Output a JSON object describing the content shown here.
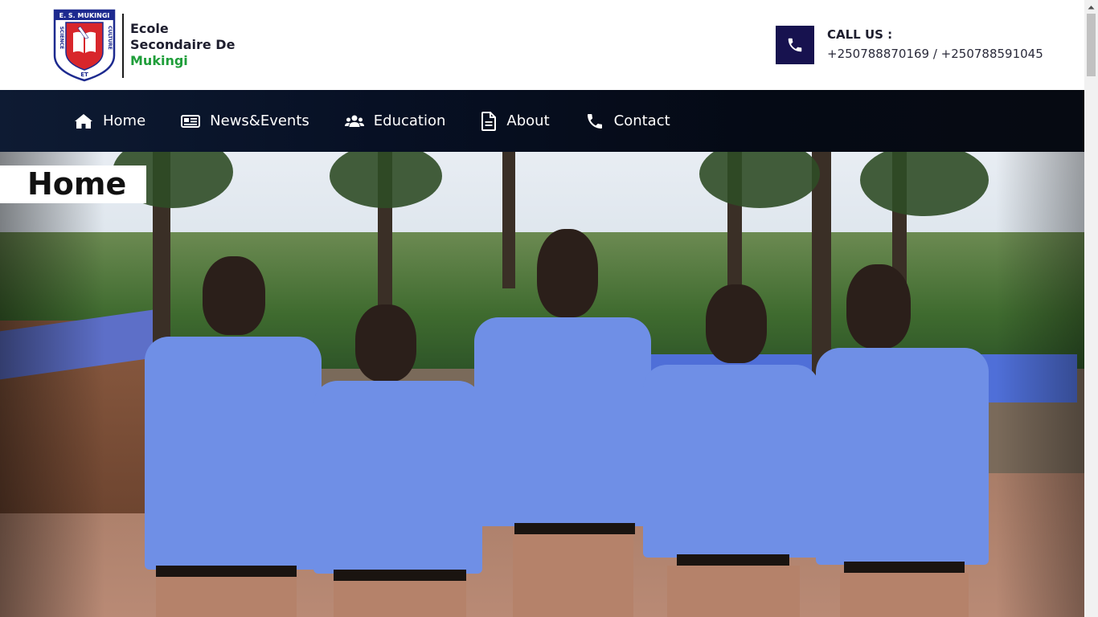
{
  "header": {
    "logo": {
      "crest_top_text": "E. S. MUKINGI",
      "crest_left_text": "SCIENCE",
      "crest_right_text": "CULTURE",
      "crest_bottom_text": "ET"
    },
    "school_name_line1": "Ecole",
    "school_name_line2": "Secondaire De",
    "school_name_line3": "Mukingi",
    "call_label": "CALL US :",
    "call_numbers": "+250788870169 / +250788591045",
    "call_icon": "phone-icon"
  },
  "nav": {
    "items": [
      {
        "label": "Home",
        "icon": "home-icon"
      },
      {
        "label": "News&Events",
        "icon": "newspaper-icon"
      },
      {
        "label": "Education",
        "icon": "users-icon"
      },
      {
        "label": "About",
        "icon": "document-icon"
      },
      {
        "label": "Contact",
        "icon": "phone-icon"
      }
    ]
  },
  "hero": {
    "page_title": "Home",
    "image": "group-of-students-in-uniform-photo"
  },
  "colors": {
    "brand_navy": "#17124f",
    "nav_background": "#050a15",
    "accent_green": "#1f9e3a",
    "crest_red": "#d8262b",
    "crest_blue": "#1d2a8f"
  }
}
